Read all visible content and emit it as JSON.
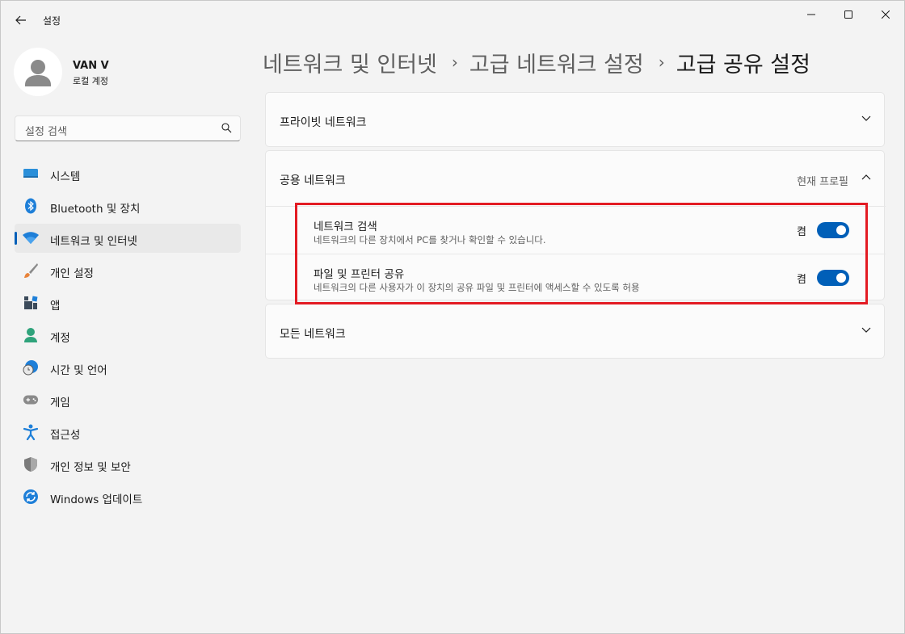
{
  "window": {
    "title": "설정",
    "back_icon": "back-arrow-icon",
    "controls": [
      "minimize-icon",
      "maximize-icon",
      "close-icon"
    ]
  },
  "profile": {
    "name": "VAN V",
    "account_type": "로컬 계정"
  },
  "search": {
    "placeholder": "설정 검색"
  },
  "sidebar": {
    "items": [
      {
        "label": "시스템",
        "icon": "system-icon",
        "active": false
      },
      {
        "label": "Bluetooth 및 장치",
        "icon": "bluetooth-icon",
        "active": false
      },
      {
        "label": "네트워크 및 인터넷",
        "icon": "wifi-icon",
        "active": true
      },
      {
        "label": "개인 설정",
        "icon": "brush-icon",
        "active": false
      },
      {
        "label": "앱",
        "icon": "apps-icon",
        "active": false
      },
      {
        "label": "계정",
        "icon": "account-icon",
        "active": false
      },
      {
        "label": "시간 및 언어",
        "icon": "time-language-icon",
        "active": false
      },
      {
        "label": "게임",
        "icon": "gamepad-icon",
        "active": false
      },
      {
        "label": "접근성",
        "icon": "accessibility-icon",
        "active": false
      },
      {
        "label": "개인 정보 및 보안",
        "icon": "shield-icon",
        "active": false
      },
      {
        "label": "Windows 업데이트",
        "icon": "update-icon",
        "active": false
      }
    ]
  },
  "breadcrumb": {
    "items": [
      "네트워크 및 인터넷",
      "고급 네트워크 설정",
      "고급 공유 설정"
    ]
  },
  "sections": {
    "private": {
      "title": "프라이빗 네트워크",
      "expanded": false
    },
    "public": {
      "title": "공용 네트워크",
      "status": "현재 프로필",
      "expanded": true,
      "settings": [
        {
          "title": "네트워크 검색",
          "description": "네트워크의 다른 장치에서 PC를 찾거나 확인할 수 있습니다.",
          "state_label": "켬",
          "on": true
        },
        {
          "title": "파일 및 프린터 공유",
          "description": "네트워크의 다른 사용자가 이 장치의 공유 파일 및 프린터에 액세스할 수 있도록 허용",
          "state_label": "켬",
          "on": true
        }
      ]
    },
    "all": {
      "title": "모든 네트워크",
      "expanded": false
    }
  },
  "colors": {
    "accent": "#005fb8",
    "highlight": "#e31b23",
    "background": "#f3f3f3",
    "card": "#fbfbfb"
  }
}
